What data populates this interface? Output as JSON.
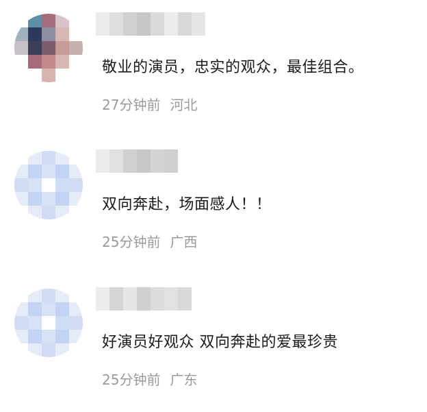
{
  "comments": [
    {
      "text": "敬业的演员，忠实的观众，最佳组合。",
      "time": "27分钟前",
      "location": "河北",
      "avatar_colors": [
        "#ffffff",
        "#5f8fa6",
        "#a56d7a",
        "#d8c4c9",
        "#ffffff",
        "#9fb2bd",
        "#2b3a5c",
        "#8c8ea0",
        "#d9b8b4",
        "#ffffff",
        "#c7c0c6",
        "#3b3f58",
        "#7c5c6c",
        "#c79c96",
        "#c6b0b0",
        "#ffffff",
        "#a5697a",
        "#c18a88",
        "#d6b7b1",
        "#ffffff",
        "#ffffff",
        "#ffffff",
        "#d8b4ae",
        "#ffffff",
        "#ffffff"
      ],
      "nick_colors": [
        "#ececec",
        "#dedede",
        "#d1d1d1",
        "#c6c6c6",
        "#dadada",
        "#ececec",
        "#d8d8d8",
        "#e6e6e6"
      ]
    },
    {
      "text": "双向奔赴，场面感人！！",
      "time": "25分钟前",
      "location": "广西",
      "avatar_colors": [
        "#ffffff",
        "#e6ecf7",
        "#d0dcf4",
        "#e6ecf7",
        "#ffffff",
        "#e6ecf7",
        "#c3d3f4",
        "#d8e2f7",
        "#c3d3f4",
        "#e6ecf7",
        "#d0dcf4",
        "#d8e2f7",
        "#ffffff",
        "#cfdcf6",
        "#d0dcf4",
        "#e6ecf7",
        "#c3d3f4",
        "#d8e2f7",
        "#c3d3f4",
        "#e6ecf7",
        "#ffffff",
        "#e6ecf7",
        "#d0dcf4",
        "#e6ecf7",
        "#ffffff"
      ],
      "nick_colors": [
        "#ececec",
        "#e0e0e0",
        "#d0d0d0",
        "#c8c8c8",
        "#d4d4d4",
        "#cfcfcf"
      ]
    },
    {
      "text": "好演员好观众 双向奔赴的爱最珍贵",
      "time": "25分钟前",
      "location": "广东",
      "avatar_colors": [
        "#ffffff",
        "#e6ecf7",
        "#d0dcf4",
        "#e6ecf7",
        "#ffffff",
        "#e6ecf7",
        "#c3d3f4",
        "#d8e2f7",
        "#c3d3f4",
        "#e6ecf7",
        "#d0dcf4",
        "#d8e2f7",
        "#ffffff",
        "#cfdcf6",
        "#d0dcf4",
        "#e6ecf7",
        "#c3d3f4",
        "#d8e2f7",
        "#c3d3f4",
        "#e6ecf7",
        "#ffffff",
        "#e6ecf7",
        "#d0dcf4",
        "#e6ecf7",
        "#ffffff"
      ],
      "nick_colors": [
        "#ececec",
        "#d6d6d6",
        "#e6e6e6",
        "#cfcfcf",
        "#dcdcdc",
        "#e2e2e2",
        "#d8d8d8"
      ]
    }
  ]
}
